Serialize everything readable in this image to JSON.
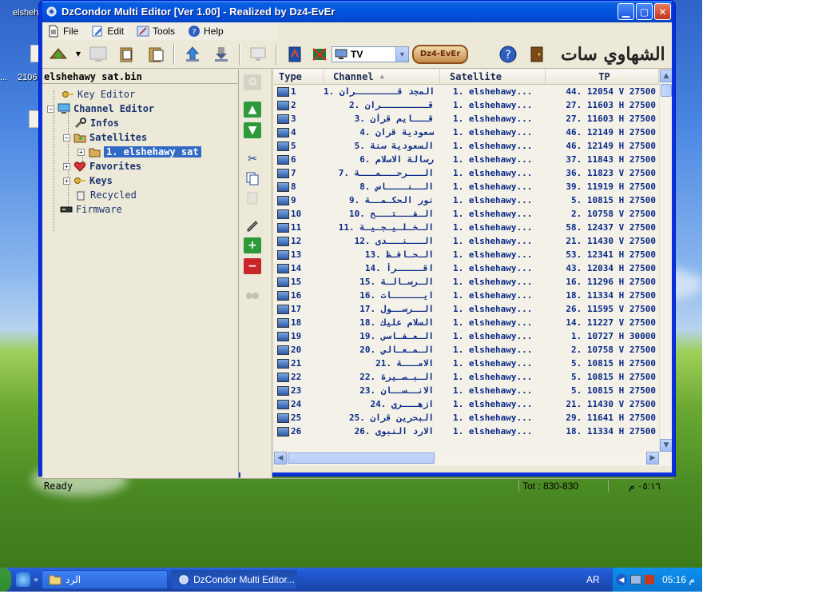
{
  "window": {
    "title": "DzCondor Multi Editor [Ver 1.00]  - Realized by Dz4-EvEr"
  },
  "menu": [
    {
      "label": "File",
      "icon": "file-icon"
    },
    {
      "label": "Edit",
      "icon": "edit-icon"
    },
    {
      "label": "Tools",
      "icon": "tools-icon"
    },
    {
      "label": "Help",
      "icon": "help-icon"
    }
  ],
  "toolbar": {
    "mode_select": "TV",
    "brand_badge": "Dz4-EvEr",
    "arabic_logo": "الشهاوي سات"
  },
  "tree": {
    "file_name": "elshehawy sat.bin",
    "items": [
      {
        "label": "Key Editor",
        "icon": "key-icon"
      },
      {
        "label": "Channel Editor",
        "icon": "monitor-icon"
      },
      {
        "label": "Infos",
        "icon": "wrench-icon"
      },
      {
        "label": "Satellites",
        "icon": "folder-satellite-icon"
      },
      {
        "label": "1. elshehawy sat",
        "icon": "satellite-icon"
      },
      {
        "label": "Favorites",
        "icon": "heart-icon"
      },
      {
        "label": "Keys",
        "icon": "key-icon"
      },
      {
        "label": "Recycled",
        "icon": "recycle-icon"
      },
      {
        "label": "Firmware",
        "icon": "chip-icon"
      }
    ]
  },
  "table": {
    "columns": [
      "Type",
      "Channel",
      "Satellite",
      "TP"
    ],
    "rows": [
      {
        "type": "1",
        "channel": "1.  المجد قــــــــران",
        "satellite": "1. elshehawy...",
        "tp": "44. 12054 V 27500"
      },
      {
        "type": "2",
        "channel": "2.  قـــــــــران",
        "satellite": "1. elshehawy...",
        "tp": "27. 11603 H 27500"
      },
      {
        "type": "3",
        "channel": "3.  قـــايم قرأن",
        "satellite": "1. elshehawy...",
        "tp": "27. 11603 H 27500"
      },
      {
        "type": "4",
        "channel": "4.  سعودية قران",
        "satellite": "1. elshehawy...",
        "tp": "46. 12149 H 27500"
      },
      {
        "type": "5",
        "channel": "5.  السعودية سنة",
        "satellite": "1. elshehawy...",
        "tp": "46. 12149 H 27500"
      },
      {
        "type": "6",
        "channel": "6.  رسالة الاسلام",
        "satellite": "1. elshehawy...",
        "tp": "37. 11843 H 27500"
      },
      {
        "type": "7",
        "channel": "7.  الـــرحـــمـــة",
        "satellite": "1. elshehawy...",
        "tp": "36. 11823 V 27500"
      },
      {
        "type": "8",
        "channel": "8.  الــنــــاس",
        "satellite": "1. elshehawy...",
        "tp": "39. 11919 H 27500"
      },
      {
        "type": "9",
        "channel": "9.  نور الحكـمــة",
        "satellite": "1. elshehawy...",
        "tp": "5. 10815 H 27500"
      },
      {
        "type": "10",
        "channel": "10.  الـفـــتـــح",
        "satellite": "1. elshehawy...",
        "tp": "2. 10758 V 27500"
      },
      {
        "type": "11",
        "channel": "11.  الـخـلـيـجـيـة",
        "satellite": "1. elshehawy...",
        "tp": "58. 12437 V 27500"
      },
      {
        "type": "12",
        "channel": "12.  الـــنـــدى",
        "satellite": "1. elshehawy...",
        "tp": "21. 11430 V 27500"
      },
      {
        "type": "13",
        "channel": "13.  الـحـافـظ",
        "satellite": "1. elshehawy...",
        "tp": "53. 12341 H 27500"
      },
      {
        "type": "14",
        "channel": "14.  اقـــــرأ",
        "satellite": "1. elshehawy...",
        "tp": "43. 12034 H 27500"
      },
      {
        "type": "15",
        "channel": "15.  الـرسـالـة",
        "satellite": "1. elshehawy...",
        "tp": "16. 11296 H 27500"
      },
      {
        "type": "16",
        "channel": "16.  ايــــــات",
        "satellite": "1. elshehawy...",
        "tp": "18. 11334 H 27500"
      },
      {
        "type": "17",
        "channel": "17.  الــرســول",
        "satellite": "1. elshehawy...",
        "tp": "26. 11595 V 27500"
      },
      {
        "type": "18",
        "channel": "18.  السلام عليك",
        "satellite": "1. elshehawy...",
        "tp": "14. 11227 V 27500"
      },
      {
        "type": "19",
        "channel": "19.  الـعـفـاسى",
        "satellite": "1. elshehawy...",
        "tp": "1. 10727 H 30000"
      },
      {
        "type": "20",
        "channel": "20.  الـمـعـالي",
        "satellite": "1. elshehawy...",
        "tp": "2. 10758 V 27500"
      },
      {
        "type": "21",
        "channel": "21.  الامـــة",
        "satellite": "1. elshehawy...",
        "tp": "5. 10815 H 27500"
      },
      {
        "type": "22",
        "channel": "22.  الـبـصـيرة",
        "satellite": "1. elshehawy...",
        "tp": "5. 10815 H 27500"
      },
      {
        "type": "23",
        "channel": "23.  الانــســان",
        "satellite": "1. elshehawy...",
        "tp": "5. 10815 H 27500"
      },
      {
        "type": "24",
        "channel": "24.  ازهـــري",
        "satellite": "1. elshehawy...",
        "tp": "21. 11430 V 27500"
      },
      {
        "type": "25",
        "channel": "25.  البحرين قران",
        "satellite": "1. elshehawy...",
        "tp": "29. 11641 H 27500"
      },
      {
        "type": "26",
        "channel": "26.  الارد النبوى",
        "satellite": "1. elshehawy...",
        "tp": "18. 11334 H 27500"
      }
    ]
  },
  "status": {
    "ready": "Ready",
    "total": "Tot : 830-830",
    "time": "٠٥:١٦ م"
  },
  "desktop": {
    "labels": [
      "elsheh",
      "2106",
      "..."
    ]
  },
  "taskbar": {
    "folder_task": "الرد",
    "editor_task": "DzCondor Multi Editor...",
    "language": "AR",
    "clock": "05:16 م"
  }
}
